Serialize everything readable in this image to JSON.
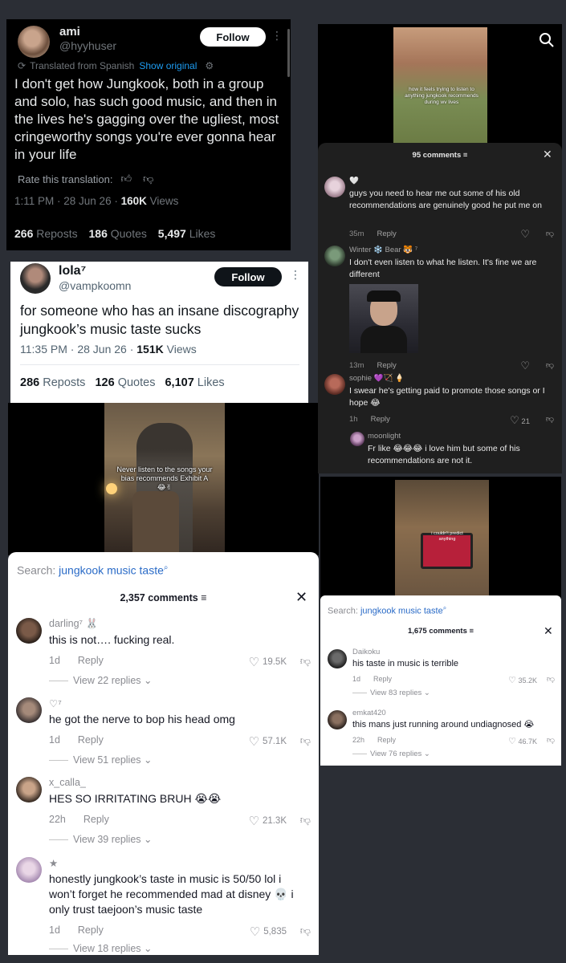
{
  "tweet1": {
    "name": "ami",
    "handle": "@hyyhuser",
    "follow": "Follow",
    "translated": "Translated from Spanish",
    "show_original": "Show original",
    "body": "I don't get how Jungkook, both in a group and solo, has such good music, and then in the lives he's gagging over the ugliest, most cringeworthy songs you're ever gonna hear in your life",
    "rate": "Rate this translation:",
    "time": "1:11 PM · 28 Jun 26 · ",
    "views_num": "160K",
    "views_label": " Views",
    "reposts_num": "266",
    "reposts_label": " Reposts",
    "quotes_num": "186",
    "quotes_label": " Quotes",
    "likes_num": "5,497",
    "likes_label": " Likes"
  },
  "tweet2": {
    "name": "lola⁷",
    "handle": "@vampkoomn",
    "follow": "Follow",
    "body": "for someone who has an insane discography jungkook’s music taste sucks",
    "time": "11:35 PM · 28 Jun 26 · ",
    "views_num": "151K",
    "views_label": " Views",
    "reposts_num": "286",
    "reposts_label": " Reposts",
    "quotes_num": "126",
    "quotes_label": " Quotes",
    "likes_num": "6,107",
    "likes_label": " Likes"
  },
  "video_left": {
    "caption": "Never listen to the songs your bias recommends Exhibit A 😂✌"
  },
  "comments_left": {
    "search_label": "Search: ",
    "search_query": "jungkook music taste",
    "count": "2,357 comments",
    "items": [
      {
        "user": "darling⁷ 🐰",
        "text": "this is not…. fucking real.",
        "time": "1d",
        "reply": "Reply",
        "likes": "19.5K",
        "view_replies": "View 22 replies ⌄"
      },
      {
        "user": "♡⁷",
        "text": "he got the nerve to bop his head omg",
        "time": "1d",
        "reply": "Reply",
        "likes": "57.1K",
        "view_replies": "View 51 replies ⌄"
      },
      {
        "user": "x_calla_",
        "text": "HES SO IRRITATING BRUH 😭😭",
        "time": "22h",
        "reply": "Reply",
        "likes": "21.3K",
        "view_replies": "View 39 replies ⌄"
      },
      {
        "user": "★",
        "text": "honestly jungkook’s taste in music is 50/50 lol i won’t forget he recommended mad at disney 💀 i only trust taejoon’s music taste",
        "time": "1d",
        "reply": "Reply",
        "likes": "5,835",
        "view_replies": "View 18 replies ⌄"
      }
    ]
  },
  "video_right_top": {
    "caption": "how it feels trying to listen to anything jungkook recommends during wv lives"
  },
  "comments_right_top": {
    "count": "95 comments",
    "items": [
      {
        "user": "🤍",
        "text": "guys you need to hear me out some of his old recommendations are genuinely good he put me on",
        "time": "35m",
        "reply": "Reply",
        "likes": ""
      },
      {
        "user": "Winter ❄️ Bear 🐯 ⁷",
        "text": "I don't even listen to what he listen. It's fine we are different",
        "time": "13m",
        "reply": "Reply",
        "likes": ""
      },
      {
        "user": "sophie 💜🏹 🍦",
        "text": "I swear he's getting paid to promote those songs or I hope 😂",
        "time": "1h",
        "reply": "Reply",
        "likes": "21"
      },
      {
        "user": "moonlight",
        "text": "Fr like 😂😂😂 i love him but some of his recommendations are not it.",
        "time": "",
        "reply": "",
        "likes": ""
      }
    ]
  },
  "video_right_bottom": {
    "caption": "i couldn't predict anything"
  },
  "comments_right_bottom": {
    "search_label": "Search: ",
    "search_query": "jungkook music taste",
    "count": "1,675 comments",
    "items": [
      {
        "user": "Daikoku",
        "text": "his taste in music is terrible",
        "time": "1d",
        "reply": "Reply",
        "likes": "35.2K",
        "view_replies": "View 83 replies ⌄"
      },
      {
        "user": "emkat420",
        "text": "this mans just running around undiagnosed 😭",
        "time": "22h",
        "reply": "Reply",
        "likes": "46.7K",
        "view_replies": "View 76 replies ⌄"
      }
    ]
  }
}
